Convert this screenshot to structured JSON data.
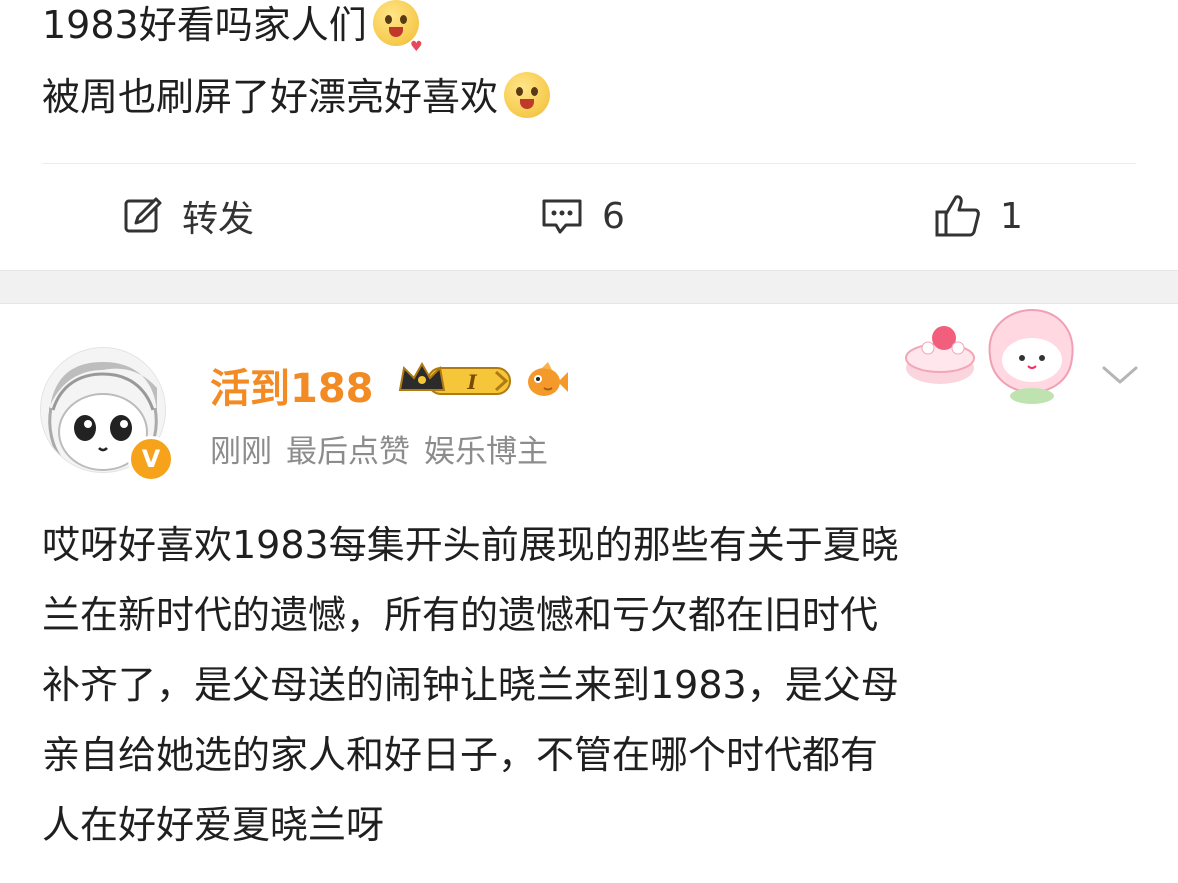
{
  "post": {
    "line1": "1983好看吗家人们",
    "line1_emoji": "pleading-face-icon",
    "line2": "被周也刷屏了好漂亮好喜欢",
    "line2_emoji": "drooling-face-icon"
  },
  "actions": {
    "repost_label": "转发",
    "comment_count": "6",
    "like_count": "1"
  },
  "comment": {
    "username": "活到188",
    "level_badge": "I",
    "meta_time": "刚刚",
    "meta_status": "最后点赞",
    "meta_role": "娱乐博主",
    "body_lines": [
      "哎呀好喜欢1983每集开头前展现的那些有关于夏晓",
      "兰在新时代的遗憾，所有的遗憾和亏欠都在旧时代",
      "补齐了，是父母送的闹钟让晓兰来到1983，是父母",
      "亲自给她选的家人和好日子，不管在哪个时代都有",
      "人在好好爱夏晓兰呀"
    ],
    "verified_mark": "V"
  },
  "colors": {
    "username": "#f28b24",
    "meta": "#8c8c8c",
    "verified": "#f7a21b"
  }
}
